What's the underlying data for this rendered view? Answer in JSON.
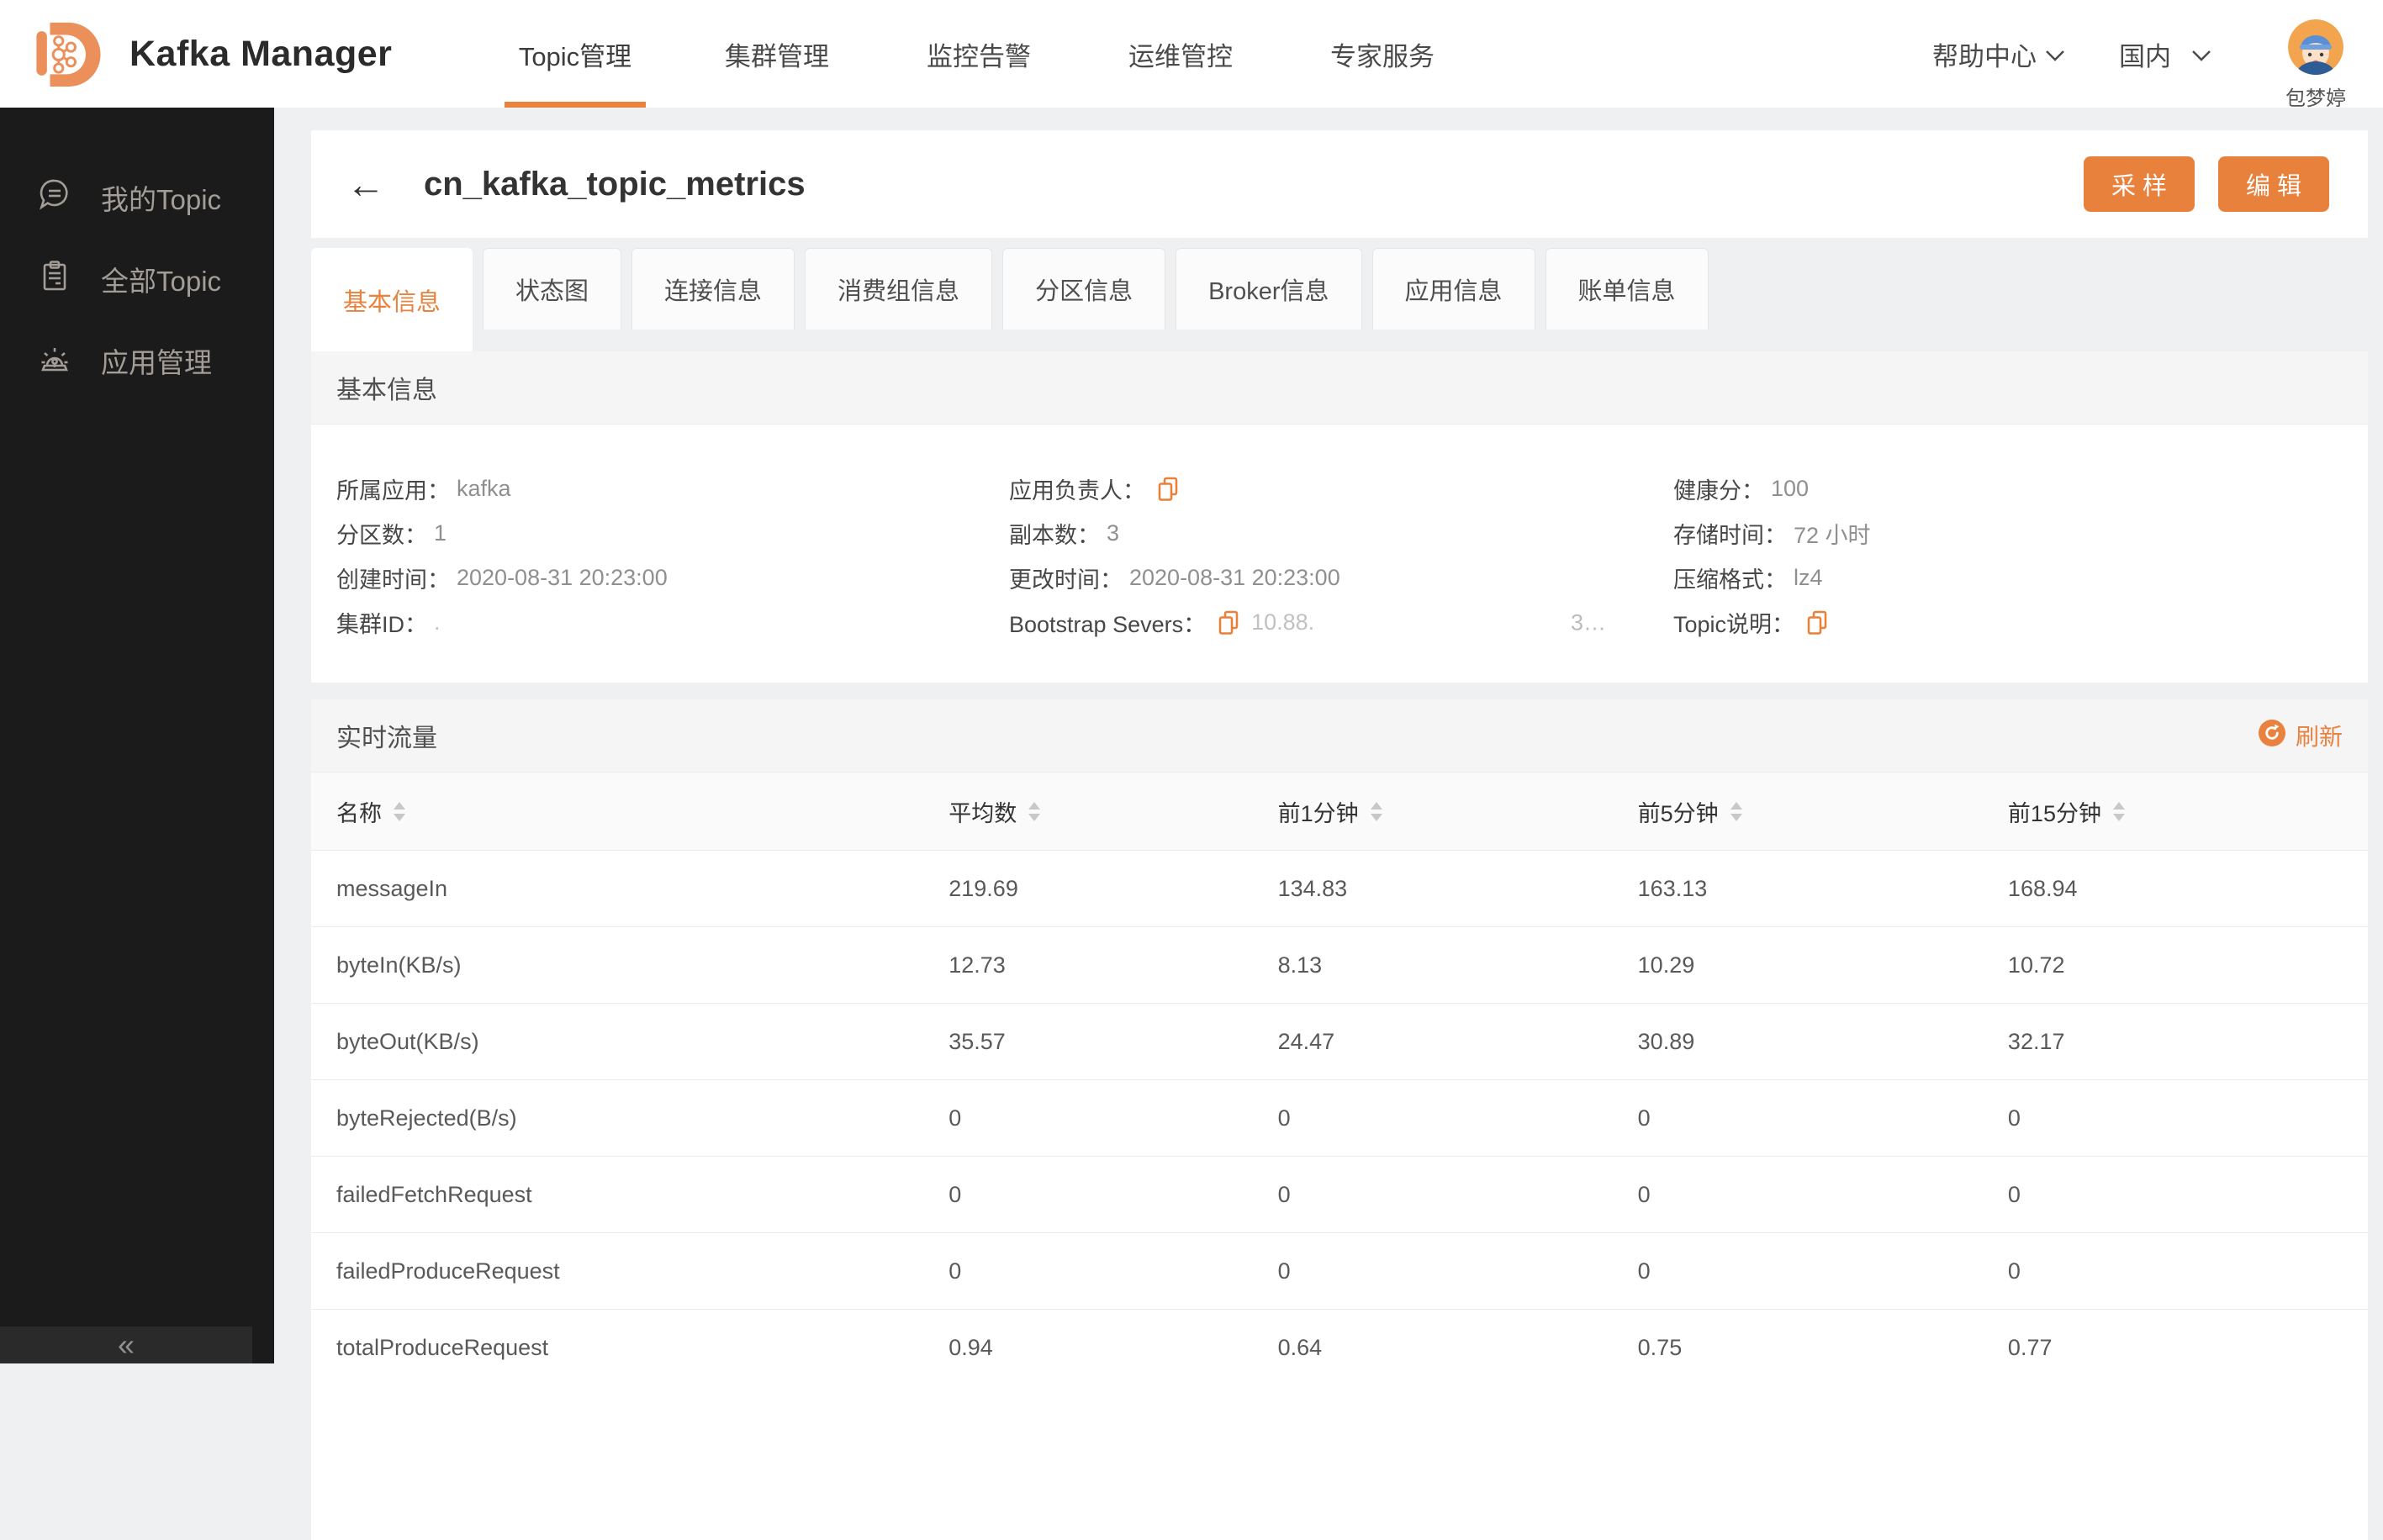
{
  "header": {
    "app_title": "Kafka Manager",
    "nav_items": [
      {
        "label": "Topic管理",
        "active": true
      },
      {
        "label": "集群管理",
        "active": false
      },
      {
        "label": "监控告警",
        "active": false
      },
      {
        "label": "运维管控",
        "active": false
      },
      {
        "label": "专家服务",
        "active": false
      }
    ],
    "help_label": "帮助中心",
    "region_label": "国内",
    "username": "包梦婷"
  },
  "sidebar": {
    "items": [
      {
        "label": "我的Topic",
        "icon": "chat-bubble-icon"
      },
      {
        "label": "全部Topic",
        "icon": "clipboard-icon"
      },
      {
        "label": "应用管理",
        "icon": "siren-icon"
      }
    ],
    "collapse_glyph": "«"
  },
  "page": {
    "back_glyph": "←",
    "title": "cn_kafka_topic_metrics",
    "sample_button": "采 样",
    "edit_button": "编 辑"
  },
  "tabs": {
    "active": "基本信息",
    "items": [
      "基本信息",
      "状态图",
      "连接信息",
      "消费组信息",
      "分区信息",
      "Broker信息",
      "应用信息",
      "账单信息"
    ]
  },
  "basic_info": {
    "section_title": "基本信息",
    "col1": [
      {
        "label": "所属应用：",
        "value": "kafka"
      },
      {
        "label": "分区数：",
        "value": "1"
      },
      {
        "label": "创建时间：",
        "value": "2020-08-31 20:23:00"
      },
      {
        "label": "集群ID：",
        "value": "."
      }
    ],
    "col2": [
      {
        "label": "应用负责人：",
        "value": "",
        "copy": true
      },
      {
        "label": "副本数：",
        "value": "3"
      },
      {
        "label": "更改时间：",
        "value": "2020-08-31 20:23:00"
      },
      {
        "label": "Bootstrap Severs：",
        "value": "10.88.",
        "value_tail": "3…",
        "copy": true
      }
    ],
    "col3": [
      {
        "label": "健康分：",
        "value": "100"
      },
      {
        "label": "存储时间：",
        "value": "72 小时"
      },
      {
        "label": "压缩格式：",
        "value": "lz4"
      },
      {
        "label": "Topic说明：",
        "value": "",
        "copy": true
      }
    ]
  },
  "traffic": {
    "section_title": "实时流量",
    "refresh_label": "刷新",
    "columns": [
      "名称",
      "平均数",
      "前1分钟",
      "前5分钟",
      "前15分钟"
    ],
    "rows": [
      {
        "name": "messageIn",
        "avg": "219.69",
        "m1": "134.83",
        "m5": "163.13",
        "m15": "168.94"
      },
      {
        "name": "byteIn(KB/s)",
        "avg": "12.73",
        "m1": "8.13",
        "m5": "10.29",
        "m15": "10.72"
      },
      {
        "name": "byteOut(KB/s)",
        "avg": "35.57",
        "m1": "24.47",
        "m5": "30.89",
        "m15": "32.17"
      },
      {
        "name": "byteRejected(B/s)",
        "avg": "0",
        "m1": "0",
        "m5": "0",
        "m15": "0"
      },
      {
        "name": "failedFetchRequest",
        "avg": "0",
        "m1": "0",
        "m5": "0",
        "m15": "0"
      },
      {
        "name": "failedProduceRequest",
        "avg": "0",
        "m1": "0",
        "m5": "0",
        "m15": "0"
      },
      {
        "name": "totalProduceRequest",
        "avg": "0.94",
        "m1": "0.64",
        "m5": "0.75",
        "m15": "0.77"
      }
    ]
  },
  "colors": {
    "accent": "#E8823E",
    "logo_orange": "#EB8F5B",
    "sidebar_bg": "#1B1B1B",
    "page_bg": "#EEF0F1"
  }
}
